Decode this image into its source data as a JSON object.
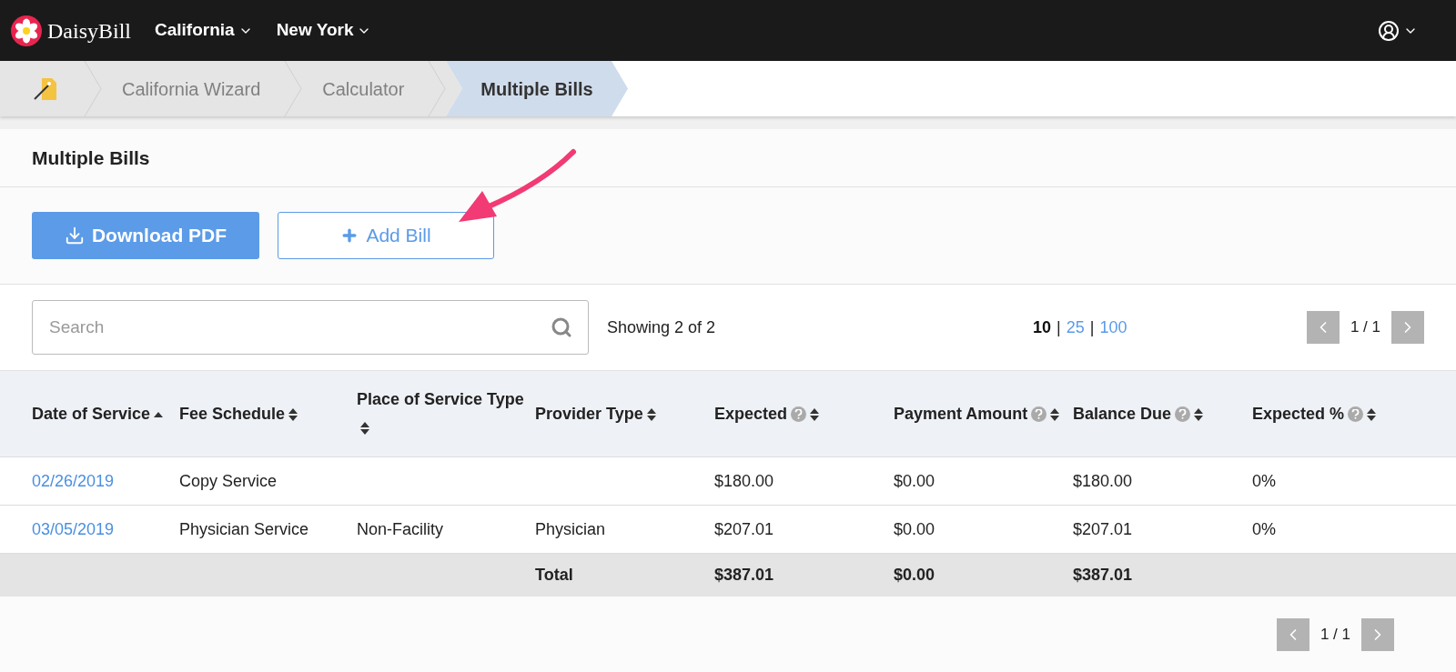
{
  "navbar": {
    "brand": "DaisyBill",
    "menus": [
      {
        "label": "California"
      },
      {
        "label": "New York"
      }
    ]
  },
  "breadcrumbs": [
    {
      "kind": "icon",
      "selected": false
    },
    {
      "kind": "text",
      "label": "California Wizard",
      "selected": false
    },
    {
      "kind": "text",
      "label": "Calculator",
      "selected": false
    },
    {
      "kind": "text",
      "label": "Multiple Bills",
      "selected": true
    }
  ],
  "panel": {
    "title": "Multiple Bills"
  },
  "buttons": [
    {
      "kind": "primary",
      "label": "Download PDF"
    },
    {
      "kind": "outline",
      "label": "Add Bill"
    }
  ],
  "search": {
    "placeholder": "Search"
  },
  "showing": "Showing 2 of 2",
  "page_sizes": [
    {
      "label": "10",
      "selected": true
    },
    {
      "separator": "|",
      "label": "25",
      "selected": false
    },
    {
      "separator": "|",
      "label": "100",
      "selected": false
    }
  ],
  "pagination": {
    "page": "1 / 1"
  },
  "table": {
    "columns": [
      {
        "label": "Date of Service",
        "help": false,
        "sorted": true
      },
      {
        "label": "Fee Schedule",
        "help": false,
        "sorted": false
      },
      {
        "label": "Place of Service Type",
        "help": false,
        "sorted": false
      },
      {
        "label": "Provider Type",
        "help": false,
        "sorted": false
      },
      {
        "label": "Expected",
        "help": true,
        "sorted": false
      },
      {
        "label": "Payment Amount",
        "help": true,
        "sorted": false
      },
      {
        "label": "Balance Due",
        "help": true,
        "sorted": false
      },
      {
        "label": "Expected %",
        "help": true,
        "sorted": false
      }
    ],
    "rows": [
      {
        "date": "02/26/2019",
        "fee_schedule": "Copy Service",
        "expected": "$180.00",
        "payment_amount": "$0.00",
        "balance_due": "$180.00",
        "expected_percent": "0%"
      },
      {
        "date": "03/05/2019",
        "fee_schedule": "Physician Service",
        "place_of_service_type": "Non-Facility",
        "provider_type": "Physician",
        "expected": "$207.01",
        "payment_amount": "$0.00",
        "balance_due": "$207.01",
        "expected_percent": "0%"
      }
    ],
    "total": {
      "provider_type": "Total",
      "expected": "$387.01",
      "payment_amount": "$0.00",
      "balance_due": "$387.01"
    }
  },
  "footer_pagination": {
    "page": "1 / 1"
  }
}
